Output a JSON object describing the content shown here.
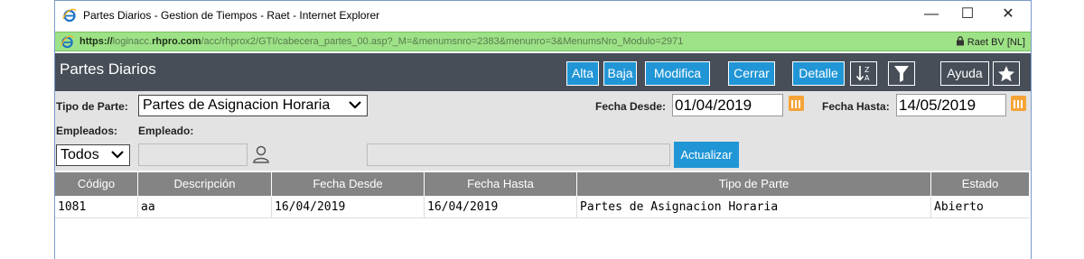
{
  "window": {
    "title": "Partes Diarios - Gestion de Tiempos - Raet - Internet Explorer",
    "controls": {
      "minimize": "—",
      "maximize": "☐",
      "close": "✕"
    }
  },
  "address_bar": {
    "scheme": "https://",
    "host_prefix": "loginacc.",
    "host_domain": "rhpro.com",
    "path": "/acc/rhprox2/GTI/cabecera_partes_00.asp?_M=&menumsnro=2383&menunro=3&MenumsNro_Modulo=2971",
    "security_label": "Raet BV [NL]"
  },
  "header": {
    "title": "Partes Diarios",
    "buttons": {
      "alta": "Alta",
      "baja": "Baja",
      "modifica": "Modifica",
      "cerrar": "Cerrar",
      "detalle": "Detalle",
      "ayuda": "Ayuda"
    },
    "icons": [
      "sort-az-icon",
      "filter-icon",
      "star-icon"
    ]
  },
  "form": {
    "tipo_parte_label": "Tipo de Parte:",
    "tipo_parte_value": "Partes de Asignacion Horaria",
    "fecha_desde_label": "Fecha Desde:",
    "fecha_desde_value": "01/04/2019",
    "fecha_hasta_label": "Fecha Hasta:",
    "fecha_hasta_value": "14/05/2019",
    "empleados_label": "Empleados:",
    "empleados_value": "Todos",
    "empleado_label": "Empleado:",
    "empleado_value": "",
    "empleado_name_value": "",
    "actualizar_label": "Actualizar"
  },
  "table": {
    "columns": [
      "Código",
      "Descripción",
      "Fecha Desde",
      "Fecha Hasta",
      "Tipo de Parte",
      "Estado"
    ],
    "rows": [
      [
        "1081",
        "aa",
        "16/04/2019",
        "16/04/2019",
        "Partes de Asignacion Horaria",
        "Abierto"
      ]
    ]
  },
  "colors": {
    "header_bg": "#474e58",
    "button_blue": "#2196d6",
    "address_green": "#9de286",
    "table_header": "#848484",
    "calendar_orange": "#f7a437"
  }
}
